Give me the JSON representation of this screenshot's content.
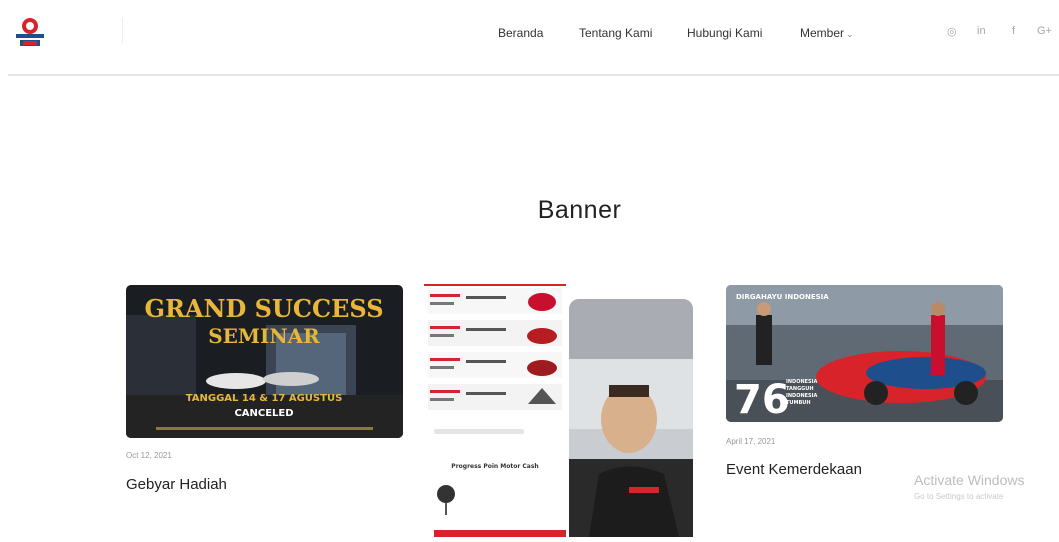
{
  "header": {
    "nav": [
      {
        "label": "Beranda"
      },
      {
        "label": "Tentang Kami"
      },
      {
        "label": "Hubungi Kami"
      },
      {
        "label": "Member"
      }
    ],
    "social": [
      {
        "icon": "instagram-icon",
        "glyph": "◎"
      },
      {
        "icon": "linkedin-icon",
        "glyph": "in"
      },
      {
        "icon": "facebook-icon",
        "glyph": "f"
      },
      {
        "icon": "google-plus-icon",
        "glyph": "G+"
      }
    ]
  },
  "section": {
    "title": "Banner"
  },
  "cards": [
    {
      "date": "Oct 12, 2021",
      "title": "Gebyar Hadiah",
      "image_text": {
        "headline_1": "GRAND SUCCESS",
        "headline_2": "SEMINAR",
        "date_line": "TANGGAL 14 & 17 AGUSTUS",
        "status": "CANCELED"
      }
    },
    {
      "image_text": {
        "caption": "Progress Poin Motor Cash"
      }
    },
    {
      "date": "April 17, 2021",
      "title": "Event Kemerdekaan",
      "image_text": {
        "top": "DIRGAHAYU INDONESIA",
        "number": "76",
        "line_1": "INDONESIA",
        "line_2": "TANGGUH",
        "line_3": "INDONESIA",
        "line_4": "TUMBUH"
      }
    }
  ],
  "watermark": {
    "title": "Activate Windows",
    "subtitle": "Go to Settings to activate"
  },
  "colors": {
    "accent_red": "#d8232a",
    "brand_blue": "#1f4e8c",
    "gold": "#e8b73a"
  }
}
